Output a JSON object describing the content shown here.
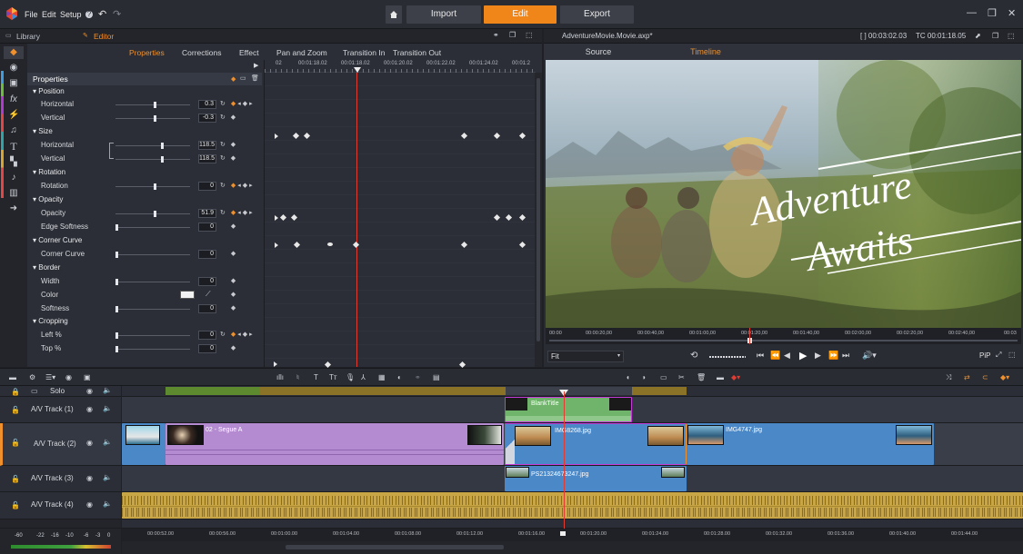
{
  "menu": {
    "file": "File",
    "edit": "Edit",
    "setup": "Setup"
  },
  "nav": {
    "import": "Import",
    "edit": "Edit",
    "export": "Export"
  },
  "colors": {
    "accent": "#f08519",
    "panel": "#2b2e36",
    "purple_clip": "#b48bd0",
    "blue_clip": "#4a88c8",
    "audio": "#c9a645",
    "green_clip": "#7ab86a",
    "playhead": "#e03c31"
  },
  "left_header": {
    "library": "Library",
    "editor": "Editor"
  },
  "subtabs": [
    "Properties",
    "Corrections",
    "Effect",
    "Pan and Zoom",
    "Transition In",
    "Transition Out"
  ],
  "props": {
    "title": "Properties",
    "position": "Position",
    "horizontal": "Horizontal",
    "horizontal_val": "0.3",
    "vertical": "Vertical",
    "vertical_val": "-0.3",
    "size": "Size",
    "size_h": "Horizontal",
    "size_h_val": "118.5",
    "size_v": "Vertical",
    "size_v_val": "118.5",
    "rotation": "Rotation",
    "rotation_sub": "Rotation",
    "rotation_val": "0",
    "opacity": "Opacity",
    "opacity_sub": "Opacity",
    "opacity_val": "51.9",
    "edge_softness": "Edge Softness",
    "edge_val": "0",
    "corner_curve": "Corner Curve",
    "corner_sub": "Corner Curve",
    "corner_val": "0",
    "border": "Border",
    "width": "Width",
    "width_val": "0",
    "color": "Color",
    "softness": "Softness",
    "softness_val": "0",
    "cropping": "Cropping",
    "left": "Left %",
    "left_val": "0",
    "top": "Top %",
    "top_val": "0"
  },
  "kf_ruler": [
    "02",
    "00:01:18.02",
    "00:01:18.02",
    "00:01:20.02",
    "00:01:22.02",
    "00:01:24.02",
    "00:01:2"
  ],
  "player": {
    "filename": "AdventureMovie.Movie.axp*",
    "duration": "[ ] 00:03:02.03",
    "tc": "TC 00:01:18.05",
    "tab_source": "Source",
    "tab_timeline": "Timeline",
    "title_line1": "Adventure",
    "title_line2": "Awaits",
    "fit": "Fit",
    "pip": "PiP",
    "ruler": [
      "00:00",
      "00:00:20,00",
      "00:00:40,00",
      "00:01:00,00",
      "00:01:20,00",
      "00:01:40,00",
      "00:02:00,00",
      "00:02:20,00",
      "00:02:40,00",
      "00:03"
    ]
  },
  "tracks": {
    "solo": "Solo",
    "t1": "A/V Track (1)",
    "t2": "A/V Track (2)",
    "t3": "A/V Track (3)",
    "t4": "A/V Track (4)",
    "clip_blank_title": "BlankTitle",
    "clip_segue": "02 - Segue A",
    "clip_img8268": "IMG8268.jpg",
    "clip_img4747": "IMG4747.jpg",
    "clip_ps": "PS21324673247.jpg"
  },
  "tl_ruler": [
    "00:00:52.00",
    "00:00:56.00",
    "00:01:00.00",
    "00:01:04.00",
    "00:01:08.00",
    "00:01:12.00",
    "00:01:16.00",
    "00:01:20.00",
    "00:01:24.00",
    "00:01:28.00",
    "00:01:32.00",
    "00:01:36.00",
    "00:01:40.00",
    "00:01:44.00"
  ],
  "meter": [
    "-60",
    "-22",
    "-16",
    "-10",
    "-6",
    "-3",
    "0"
  ]
}
